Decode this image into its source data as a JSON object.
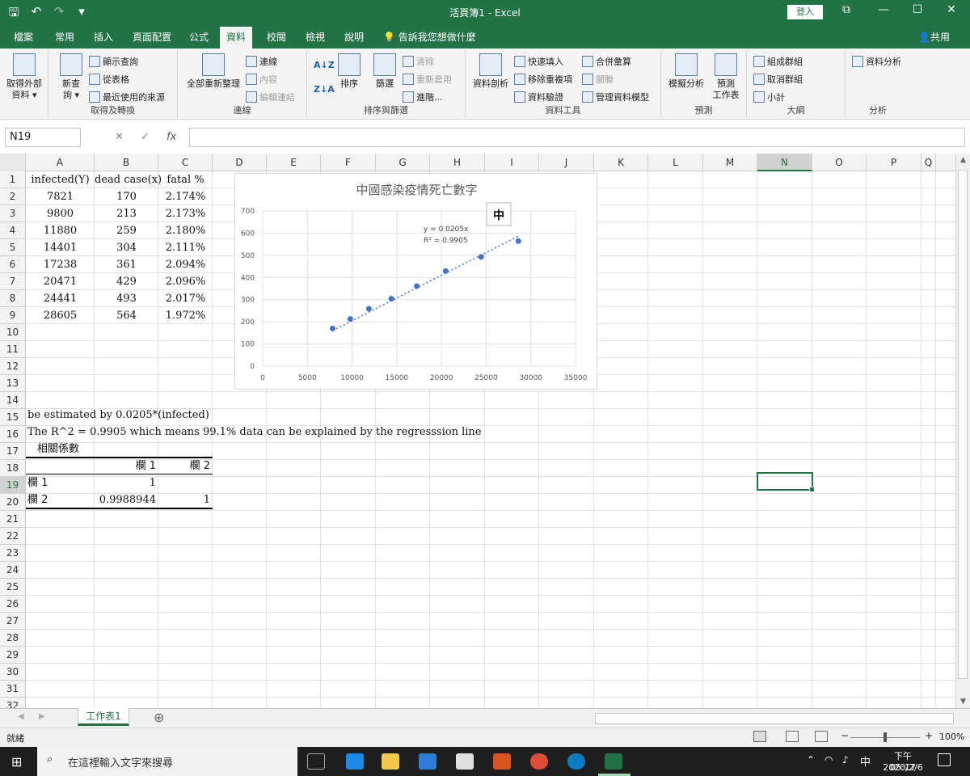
{
  "window": {
    "title": "活頁簿1 - Excel",
    "signin": "登入",
    "qat": {
      "save": "🖫",
      "undo": "↶",
      "redo": "↷",
      "more": "▾"
    },
    "controls": {
      "restore": "⧉",
      "minimize": "—",
      "maximize": "☐",
      "close": "✕"
    }
  },
  "tabs": [
    "檔案",
    "常用",
    "插入",
    "頁面配置",
    "公式",
    "資料",
    "校閱",
    "檢視",
    "說明"
  ],
  "active_tab": "資料",
  "tellme": "告訴我您想做什麼",
  "share": "共用",
  "ribbon": {
    "get_external": "取得外部\n資料 ▾",
    "new_query": "新查\n詢 ▾",
    "show_queries": "顯示查詢",
    "from_table": "從表格",
    "recent_sources": "最近使用的來源",
    "group_get": "取得及轉換",
    "refresh_all": "全部重新整理",
    "connections": "連線",
    "properties": "內容",
    "edit_links": "編輯連結",
    "group_conn": "連線",
    "sort": "排序",
    "filter": "篩選",
    "clear": "清除",
    "reapply": "重新套用",
    "advanced": "進階...",
    "group_sort": "排序與篩選",
    "text_to_cols": "資料剖析",
    "flash_fill": "快速填入",
    "remove_dup": "移除重複項",
    "validation": "資料驗證",
    "consolidate": "合併彙算",
    "relationships": "關聯",
    "data_model": "管理資料模型",
    "group_tools": "資料工具",
    "whatif": "模擬分析",
    "forecast": "預測\n工作表",
    "group_forecast": "預測",
    "group_btn": "組成群組",
    "ungroup": "取消群組",
    "subtotal": "小計",
    "group_outline": "大綱",
    "analysis": "資料分析",
    "group_analysis": "分析"
  },
  "formula_bar": {
    "name_box": "N19",
    "cancel": "✕",
    "enter": "✓",
    "fx": "fx",
    "value": ""
  },
  "columns": [
    "A",
    "B",
    "C",
    "D",
    "E",
    "F",
    "G",
    "H",
    "I",
    "J",
    "K",
    "L",
    "M",
    "N",
    "O",
    "P",
    "Q"
  ],
  "selected_column": "N",
  "selected_row": "19",
  "rows": [
    "1",
    "2",
    "3",
    "4",
    "5",
    "6",
    "7",
    "8",
    "9",
    "10",
    "11",
    "12",
    "13",
    "14",
    "15",
    "16",
    "17",
    "18",
    "19",
    "20",
    "21",
    "22",
    "23",
    "24",
    "25",
    "26",
    "27",
    "28",
    "29",
    "30",
    "31",
    "32"
  ],
  "table": {
    "headers": [
      "infected(Y)",
      "dead case(x)",
      "fatal %"
    ],
    "rows": [
      [
        "7821",
        "170",
        "2.174%"
      ],
      [
        "9800",
        "213",
        "2.173%"
      ],
      [
        "11880",
        "259",
        "2.180%"
      ],
      [
        "14401",
        "304",
        "2.111%"
      ],
      [
        "17238",
        "361",
        "2.094%"
      ],
      [
        "20471",
        "429",
        "2.096%"
      ],
      [
        "24441",
        "493",
        "2.017%"
      ],
      [
        "28605",
        "564",
        "1.972%"
      ]
    ]
  },
  "notes": {
    "row15": "be estimated by 0.0205*(infected)",
    "row16": "The R^2 = 0.9905 which means 99.1% data can be explained by the regresssion line"
  },
  "corr": {
    "title": "相關係數",
    "col1": "欄 1",
    "col2": "欄 2",
    "r19_label": "欄 1",
    "r19_v1": "1",
    "r20_label": "欄 2",
    "r20_v1": "0.9988944",
    "r20_v2": "1"
  },
  "chart_data": {
    "type": "scatter",
    "title": "中國感染疫情死亡數字",
    "x": [
      7821,
      9800,
      11880,
      14401,
      17238,
      20471,
      24441,
      28605
    ],
    "y": [
      170,
      213,
      259,
      304,
      361,
      429,
      493,
      564
    ],
    "xlim": [
      0,
      35000
    ],
    "ylim": [
      0,
      700
    ],
    "xticks": [
      "0",
      "5000",
      "10000",
      "15000",
      "20000",
      "25000",
      "30000",
      "35000"
    ],
    "yticks": [
      "0",
      "100",
      "200",
      "300",
      "400",
      "500",
      "600",
      "700"
    ],
    "trendline": {
      "slope": 0.0205,
      "equation": "y = 0.0205x",
      "r2": "R² = 0.9905"
    },
    "grid": true,
    "series_color": "#4472c4"
  },
  "ime_badge": "中",
  "sheet_tab": "工作表1",
  "add_sheet": "⊕",
  "status": {
    "ready": "就緒",
    "zoom": "100%"
  },
  "taskbar": {
    "search": "在這裡輸入文字來搜尋",
    "ime": "中",
    "time": "下午 05:17",
    "date": "2020/2/6"
  }
}
